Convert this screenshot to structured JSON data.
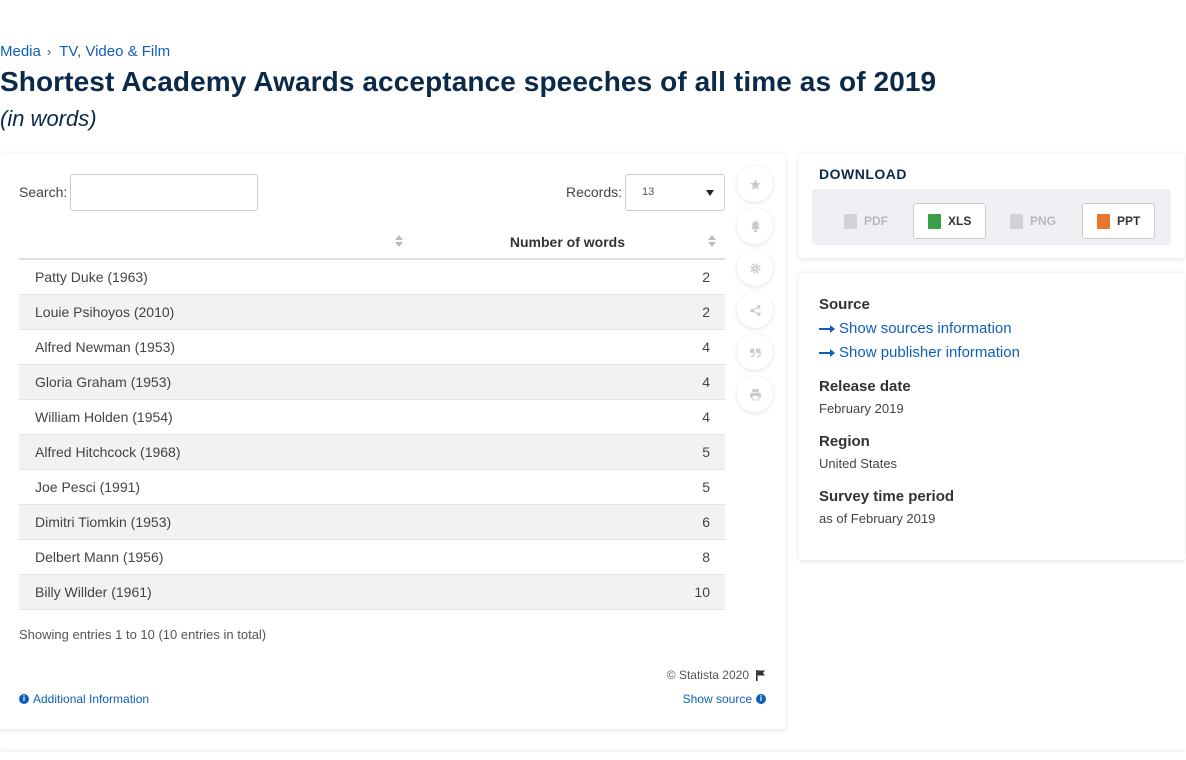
{
  "breadcrumb": {
    "items": [
      "Media",
      "TV, Video & Film"
    ],
    "separator": "›"
  },
  "title": "Shortest Academy Awards acceptance speeches of all time as of 2019",
  "subtitle": "(in words)",
  "controls": {
    "search_label": "Search:",
    "search_value": "",
    "records_label": "Records:",
    "records_value": "13"
  },
  "table": {
    "columns": [
      "",
      "Number of words"
    ],
    "rows": [
      {
        "name": "Patty Duke (1963)",
        "value": "2"
      },
      {
        "name": "Louie Psihoyos (2010)",
        "value": "2"
      },
      {
        "name": "Alfred Newman (1953)",
        "value": "4"
      },
      {
        "name": "Gloria Graham (1953)",
        "value": "4"
      },
      {
        "name": "William Holden (1954)",
        "value": "4"
      },
      {
        "name": "Alfred Hitchcock (1968)",
        "value": "5"
      },
      {
        "name": "Joe Pesci (1991)",
        "value": "5"
      },
      {
        "name": "Dimitri Tiomkin (1953)",
        "value": "6"
      },
      {
        "name": "Delbert Mann (1956)",
        "value": "8"
      },
      {
        "name": "Billy Willder (1961)",
        "value": "10"
      }
    ]
  },
  "footer": {
    "entries_text": "Showing entries 1 to 10 (10 entries in total)",
    "copyright": "© Statista 2020",
    "additional_info": "Additional Information",
    "show_source": "Show source"
  },
  "toolbar": {
    "icons": [
      "star-icon",
      "bell-icon",
      "gear-icon",
      "share-icon",
      "quote-icon",
      "print-icon"
    ]
  },
  "download": {
    "title": "DOWNLOAD",
    "buttons": [
      {
        "label": "PDF",
        "enabled": false
      },
      {
        "label": "XLS",
        "enabled": true
      },
      {
        "label": "PNG",
        "enabled": false
      },
      {
        "label": "PPT",
        "enabled": true
      }
    ]
  },
  "source_panel": {
    "source_heading": "Source",
    "show_sources": "Show sources information",
    "show_publisher": "Show publisher information",
    "release_heading": "Release date",
    "release_value": "February 2019",
    "region_heading": "Region",
    "region_value": "United States",
    "survey_heading": "Survey time period",
    "survey_value": "as of February 2019"
  },
  "colors": {
    "link": "#0f5fb8",
    "title": "#0b2a4a",
    "xls_green": "#3aa047",
    "ppt_orange": "#e8762b"
  }
}
